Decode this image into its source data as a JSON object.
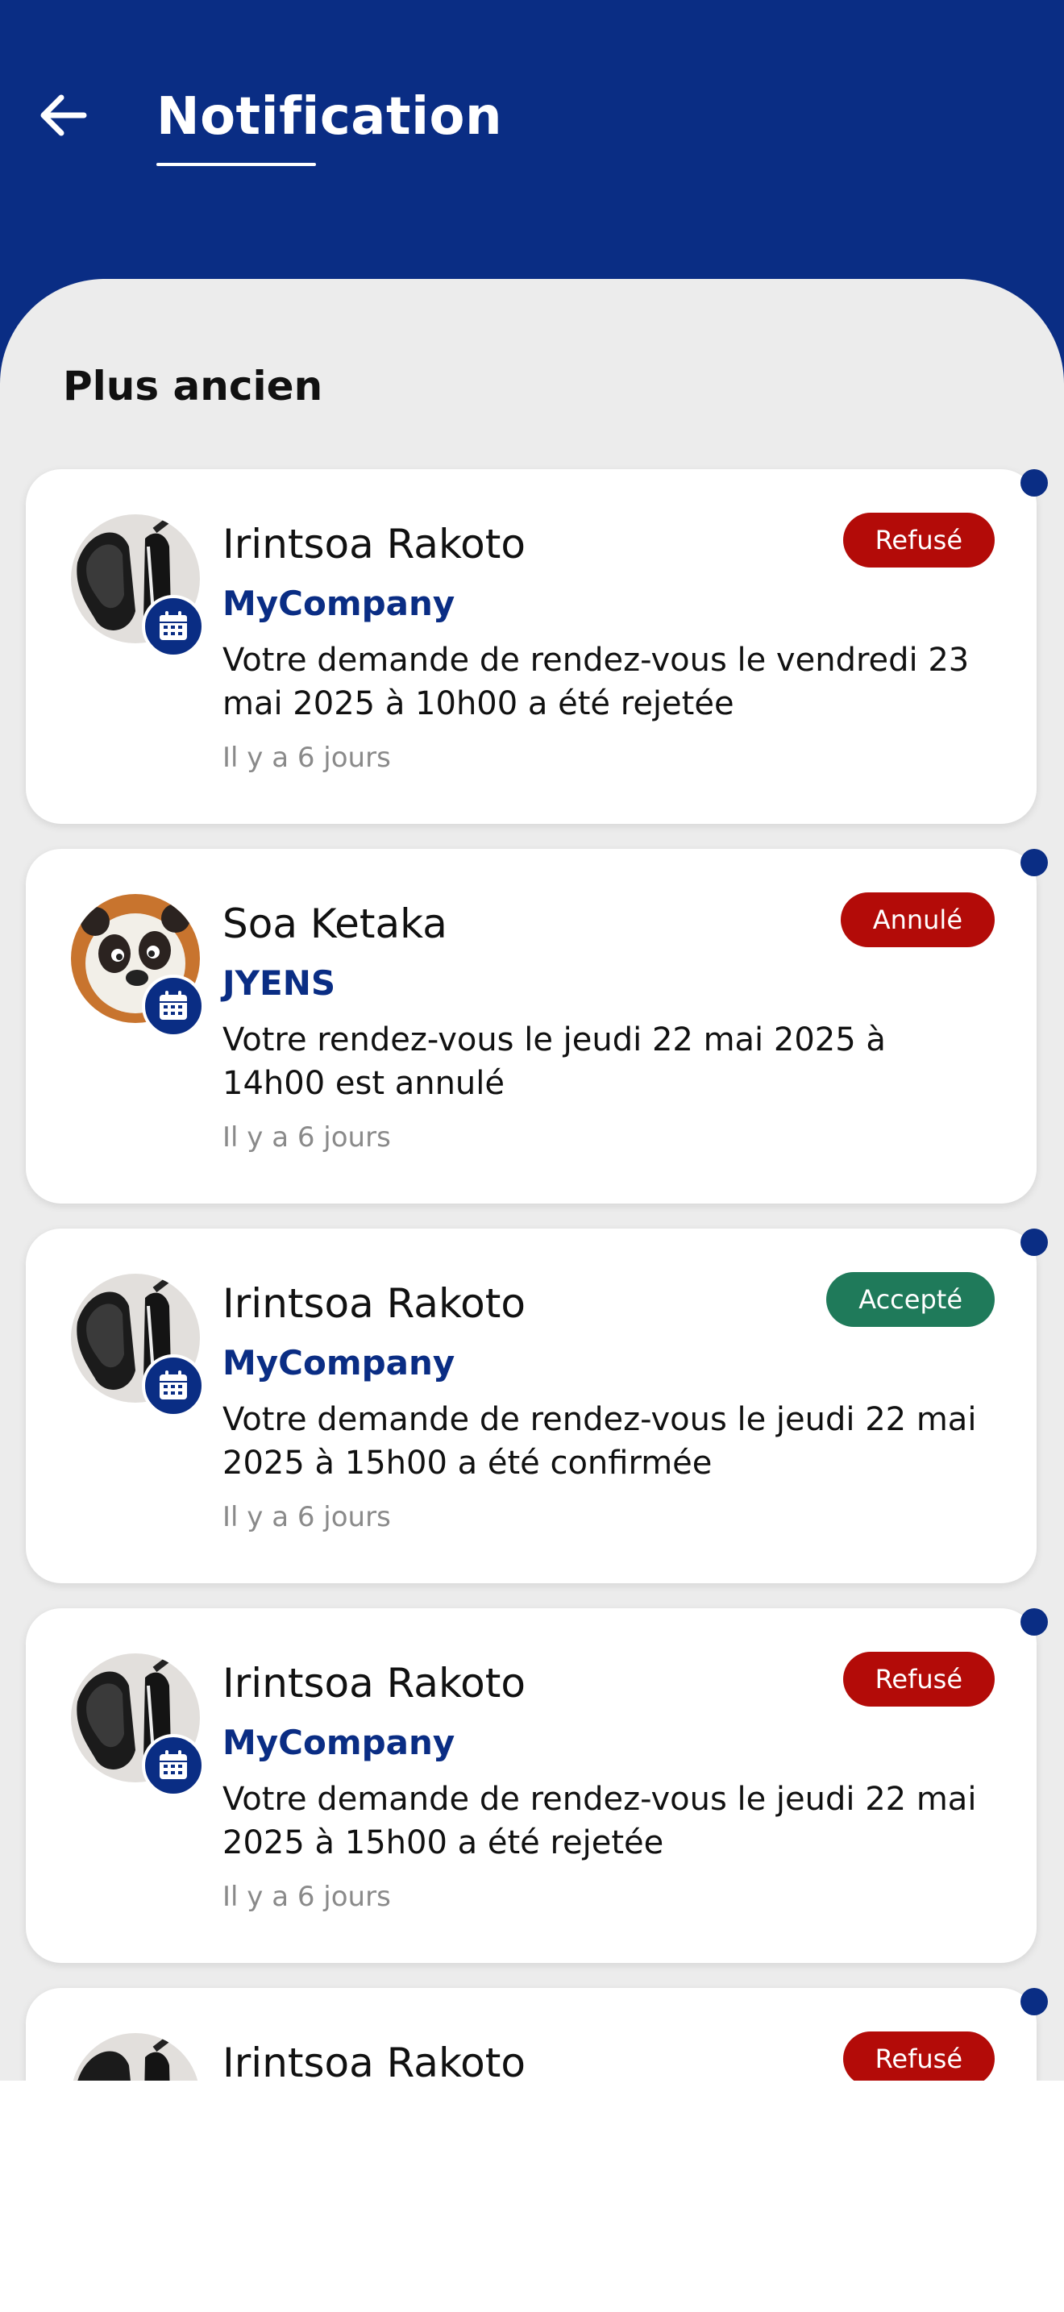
{
  "header": {
    "title": "Notification",
    "background": "#0a2d84",
    "back_icon": "arrow-left-icon"
  },
  "section": {
    "title": "Plus ancien"
  },
  "colors": {
    "brand": "#0a2d84",
    "refused": "#b30b08",
    "accepted": "#1f7a5a",
    "unread_dot": "#0a2d84"
  },
  "notifications": [
    {
      "sender": "Irintsoa Rakoto",
      "company": "MyCompany",
      "message": "Votre demande de rendez-vous le vendredi 23 mai 2025 à 10h00 a été rejetée",
      "time": "Il y a 6 jours",
      "status": "Refusé",
      "avatar": "shoes-avatar",
      "badge_icon": "calendar-icon",
      "unread": true
    },
    {
      "sender": "Soa Ketaka",
      "company": "JYENS",
      "message": "Votre rendez-vous le jeudi 22 mai 2025 à 14h00 est annulé",
      "time": "Il y a 6 jours",
      "status": "Annulé",
      "avatar": "panda-avatar",
      "badge_icon": "calendar-icon",
      "unread": true
    },
    {
      "sender": "Irintsoa Rakoto",
      "company": "MyCompany",
      "message": "Votre demande de rendez-vous le jeudi 22 mai 2025 à 15h00 a été confirmée",
      "time": "Il y a 6 jours",
      "status": "Accepté",
      "avatar": "shoes-avatar",
      "badge_icon": "calendar-icon",
      "unread": true
    },
    {
      "sender": "Irintsoa Rakoto",
      "company": "MyCompany",
      "message": "Votre demande de rendez-vous le jeudi 22 mai 2025 à 15h00 a été rejetée",
      "time": "Il y a 6 jours",
      "status": "Refusé",
      "avatar": "shoes-avatar",
      "badge_icon": "calendar-icon",
      "unread": true
    },
    {
      "sender": "Irintsoa Rakoto",
      "status": "Refusé",
      "avatar": "shoes-avatar",
      "unread": true
    }
  ]
}
